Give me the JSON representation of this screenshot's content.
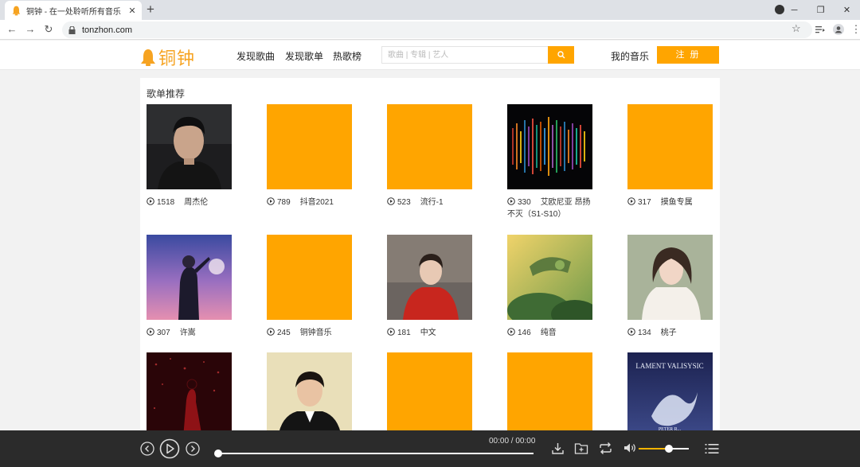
{
  "browser": {
    "tab_title": "铜钟 - 在一处聆听所有音乐",
    "tab_close": "✕",
    "new_tab": "+",
    "url": "tonzhon.com"
  },
  "header": {
    "logo_text": "铜钟",
    "nav": [
      "发现歌曲",
      "发现歌单",
      "热歌榜"
    ],
    "search_placeholder": "歌曲 | 专辑 | 艺人",
    "my_music": "我的音乐",
    "register": "注 册",
    "accent": "#ffa500"
  },
  "section": {
    "title": "歌单推荐"
  },
  "playlists": [
    {
      "count": "1518",
      "name": "周杰伦",
      "cover": "photo-man-dark"
    },
    {
      "count": "789",
      "name": "抖音2021",
      "cover": "orange"
    },
    {
      "count": "523",
      "name": "流行-1",
      "cover": "orange"
    },
    {
      "count": "330",
      "name": "艾欧尼亚 昂扬不灭（S1-S10）",
      "cover": "abstract-lights"
    },
    {
      "count": "317",
      "name": "摸鱼专属",
      "cover": "orange"
    },
    {
      "count": "307",
      "name": "许嵩",
      "cover": "photo-purple-sky"
    },
    {
      "count": "245",
      "name": "铜钟音乐",
      "cover": "orange"
    },
    {
      "count": "181",
      "name": "中文",
      "cover": "photo-red-hoodie"
    },
    {
      "count": "146",
      "name": "纯音",
      "cover": "art-green"
    },
    {
      "count": "134",
      "name": "桃子",
      "cover": "photo-girl"
    },
    {
      "count": "",
      "name": "",
      "cover": "photo-red-stage"
    },
    {
      "count": "",
      "name": "",
      "cover": "photo-tuxedo"
    },
    {
      "count": "",
      "name": "",
      "cover": "orange"
    },
    {
      "count": "",
      "name": "",
      "cover": "orange"
    },
    {
      "count": "",
      "name": "",
      "cover": "album-lament"
    }
  ],
  "album_art_text": {
    "title": "LAMENT VALISYSIC",
    "artist": "PETER R..."
  },
  "player": {
    "time": "00:00 / 00:00",
    "progress": 0,
    "volume": 0.6
  }
}
